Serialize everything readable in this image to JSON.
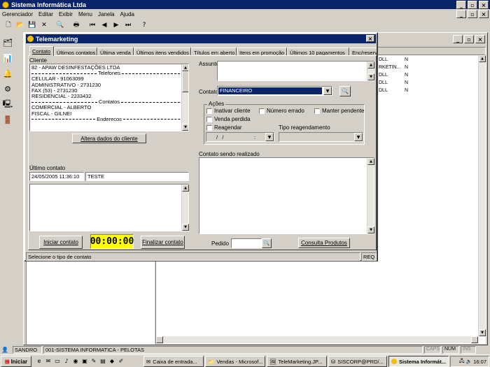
{
  "app": {
    "title": "Sistema Informática Ltda",
    "menu": [
      "Gerenciador",
      "Editar",
      "Exibir",
      "Menu",
      "Janela",
      "Ajuda"
    ]
  },
  "dialog": {
    "title": "Telemarketing",
    "tabs": [
      "Contato",
      "Últimos contatos",
      "Última venda",
      "Últimos itens vendidos",
      "Títulos em aberto",
      "Itens em promoção",
      "Últimos 10 pagamentos",
      "Enc/reserv"
    ],
    "cliente_label": "Cliente",
    "cliente_lines": [
      {
        "text": "82 - APAW DESINFESTAÇÕES LTDA",
        "type": "item"
      },
      {
        "text": "Telefones",
        "type": "sep"
      },
      {
        "text": "CELULAR - 91063099",
        "type": "item"
      },
      {
        "text": "ADMINISTRATIVO - 2731230",
        "type": "item"
      },
      {
        "text": "FAX (53) - 2731230",
        "type": "item"
      },
      {
        "text": "RESIDENCIAL - 2233432",
        "type": "item"
      },
      {
        "text": "Contatos",
        "type": "sep"
      },
      {
        "text": "COMERCIAL - ALBERTO",
        "type": "item"
      },
      {
        "text": "FISCAL - GILNEI",
        "type": "item"
      },
      {
        "text": "Enderecos",
        "type": "sep"
      }
    ],
    "alterar_button": "Altera dados do cliente",
    "ultimo_contato_label": "Último contato",
    "ultimo_contato_date": "24/05/2005 11:36:10",
    "ultimo_contato_text": "TESTE",
    "iniciar_button": "Iniciar contato",
    "timer": "00:00:00",
    "finalizar_button": "Finalizar contato",
    "assunto_label": "Assunto",
    "contato_label": "Contato",
    "contato_value": "FINANCEIRO",
    "acoes_label": "Ações",
    "checks": {
      "inativar": "Inativar cliente",
      "numero_errado": "Número errado",
      "manter_pendente": "Manter pendente",
      "venda_perdida": "Venda perdida",
      "reagendar": "Reagendar"
    },
    "date_value": "/   /",
    "time_value": ":",
    "tipo_reag_label": "Tipo reagendamento",
    "contato_sendo_label": "Contato sendo realizado",
    "pedido_label": "Pedido",
    "consulta_button": "Consulta Produtos",
    "status_text": "Selecione o tipo de contato",
    "status_req": "REQ"
  },
  "bg_table": {
    "rows": [
      {
        "c1": "DLL",
        "c2": "N"
      },
      {
        "c1": "RKETIN...",
        "c2": "N"
      },
      {
        "c1": "DLL",
        "c2": "N"
      },
      {
        "c1": "DLL",
        "c2": "N"
      },
      {
        "c1": "DLL",
        "c2": "N"
      }
    ]
  },
  "statusbar": {
    "user": "SANDRO",
    "company": "001-SISTEMA INFORMATICA - PELOTAS",
    "caps": "CAPS",
    "num": "NUM",
    "ins": "INS"
  },
  "taskbar": {
    "start": "Iniciar",
    "tasks": [
      "Caixa de entrada...",
      "Vendas - Microsof...",
      "TeleMarketing.JP...",
      "SISCORP@PRD/...",
      "Sistema Informát..."
    ],
    "clock": "16:07"
  }
}
